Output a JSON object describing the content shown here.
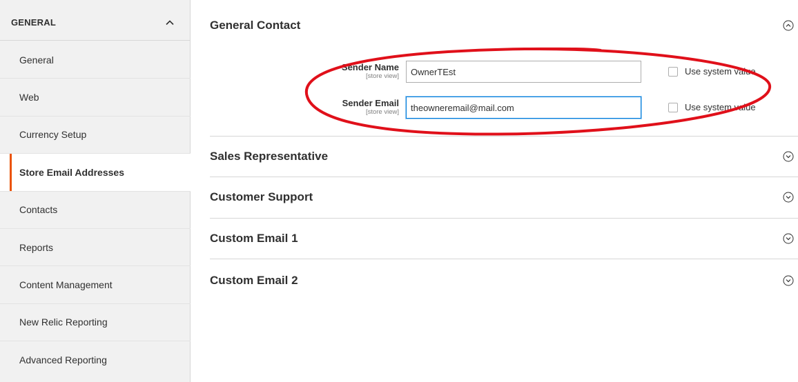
{
  "sidebar": {
    "header": "GENERAL",
    "items": [
      {
        "label": "General"
      },
      {
        "label": "Web"
      },
      {
        "label": "Currency Setup"
      },
      {
        "label": "Store Email Addresses"
      },
      {
        "label": "Contacts"
      },
      {
        "label": "Reports"
      },
      {
        "label": "Content Management"
      },
      {
        "label": "New Relic Reporting"
      },
      {
        "label": "Advanced Reporting"
      }
    ],
    "active_item": "Store Email Addresses"
  },
  "sections": [
    {
      "title": "General Contact",
      "expanded": true
    },
    {
      "title": "Sales Representative",
      "expanded": false
    },
    {
      "title": "Customer Support",
      "expanded": false
    },
    {
      "title": "Custom Email 1",
      "expanded": false
    },
    {
      "title": "Custom Email 2",
      "expanded": false
    }
  ],
  "general_contact": {
    "sender_name": {
      "label": "Sender Name",
      "scope": "[store view]",
      "value": "OwnerTEst",
      "use_system_label": "Use system value",
      "use_system_checked": false
    },
    "sender_email": {
      "label": "Sender Email",
      "scope": "[store view]",
      "value": "theowneremail@mail.com",
      "use_system_label": "Use system value",
      "use_system_checked": false
    }
  },
  "colors": {
    "accent": "#eb5202",
    "annotation_ring": "#e0101a",
    "focus_border": "#007bdb"
  }
}
